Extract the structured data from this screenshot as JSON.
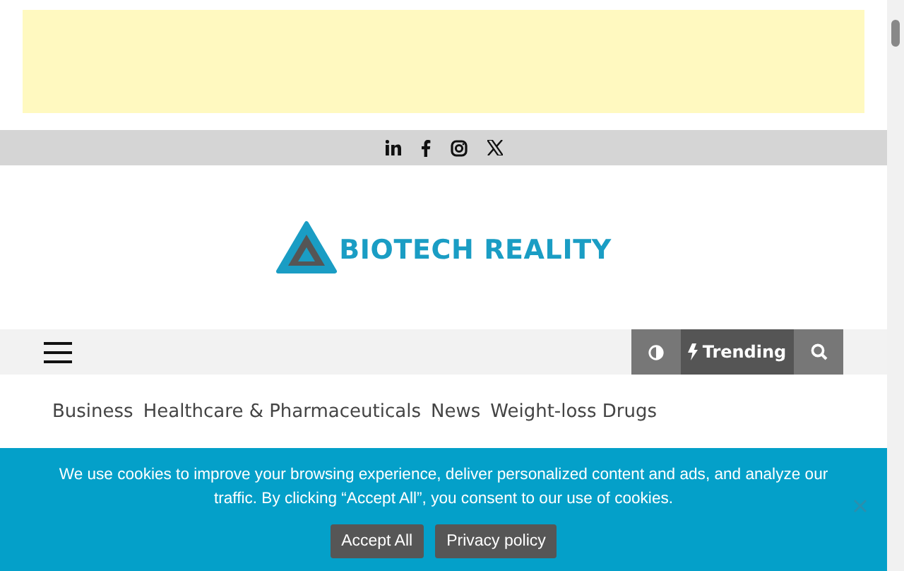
{
  "social_links": [
    {
      "kind": "linkedin"
    },
    {
      "kind": "facebook"
    },
    {
      "kind": "instagram"
    },
    {
      "kind": "x"
    }
  ],
  "logo": {
    "text": "BIOTECH REALITY"
  },
  "nav": {
    "buttons": [
      {
        "kind": "contrast"
      },
      {
        "kind": "trending",
        "label": "Trending"
      },
      {
        "kind": "search"
      }
    ]
  },
  "categories": [
    "Business",
    "Healthcare & Pharmaceuticals",
    "News",
    "Weight-loss Drugs"
  ],
  "cookie_banner": {
    "message": "We use cookies to improve your browsing experience, deliver personalized content and ads, and analyze our traffic. By clicking “Accept All”, you consent to our use of cookies.",
    "buttons": [
      "Accept All",
      "Privacy policy"
    ]
  }
}
